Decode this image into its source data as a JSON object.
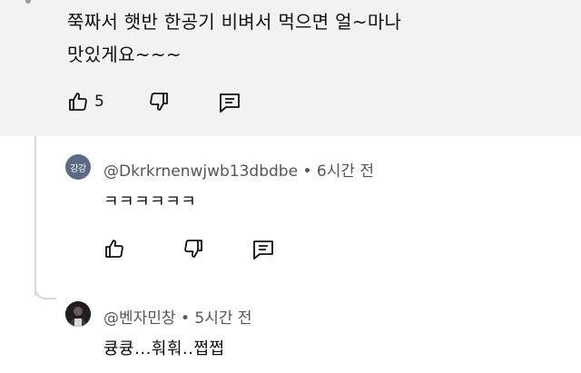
{
  "parent_comment": {
    "text_line1": "쭉짜서 햇반 한공기 비벼서 먹으면 얼~마나",
    "text_line2": "맛있게요~~~",
    "like_count": "5",
    "icons": [
      "thumbs-up-icon",
      "thumbs-down-icon",
      "reply-icon"
    ]
  },
  "replies": [
    {
      "avatar_text": "강강",
      "handle": "@Dkrkrnenwjwb13dbdbe",
      "separator": "•",
      "time": "6시간 전",
      "text": "ㅋㅋㅋㅋㅋㅋ",
      "colors": {
        "avatar_bg": "#5b6b86"
      }
    },
    {
      "handle": "@벤자민창",
      "separator": "•",
      "time": "5시간 전",
      "text": "큥큥...훠훠..쩝쩝",
      "colors": {
        "avatar_bg": "#1f1f1f"
      }
    }
  ]
}
